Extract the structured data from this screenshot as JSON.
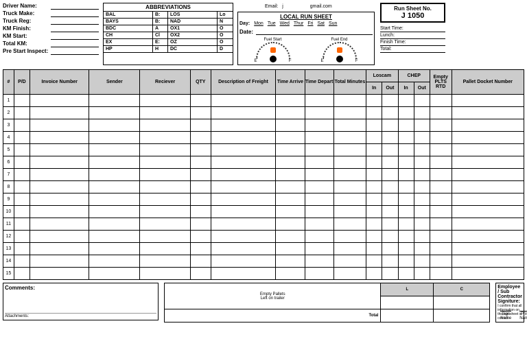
{
  "driver": {
    "fields": [
      "Driver Name:",
      "Truck Make:",
      "Truck Reg:",
      "KM Finish:",
      "KM Start:",
      "Total KM:",
      "Pre Start Inspect:"
    ]
  },
  "abb": {
    "title": "ABBREVIATIONS",
    "rows": [
      [
        "BAL",
        "B:",
        "LOS",
        "Lo"
      ],
      [
        "BAYS",
        "B:",
        "NAD",
        "N"
      ],
      [
        "BDC",
        "A",
        "OX1",
        "O"
      ],
      [
        "CH",
        "Cl",
        "OX2",
        "O"
      ],
      [
        "EX",
        "E:",
        "OZ",
        "O"
      ],
      [
        "HP",
        "H",
        "DC",
        "D"
      ]
    ]
  },
  "maintitle": "    ",
  "emailprefix": "Email:",
  "emailsuffix": "gmail.com",
  "emailmid": "j",
  "run": {
    "title": "LOCAL RUN SHEET",
    "daylabel": "Day:",
    "days": [
      "Mon",
      "Tue",
      "Wed",
      "Thur",
      "Fri",
      "Sat",
      "Sun"
    ],
    "datelabel": "Date:",
    "fuelstart": "Fuel Start",
    "fuelend": "Fuel End",
    "e": "E",
    "f": "F"
  },
  "sheet": {
    "label": "Run Sheet No.",
    "no": "J 1050"
  },
  "times": [
    "Start Time:",
    "Lunch:",
    "Finish Time:",
    "Total:"
  ],
  "cols": {
    "num": "#",
    "pd": "P/D",
    "inv": "Invoice Number",
    "sender": "Sender",
    "recv": "Reciever",
    "qty": "QTY",
    "desc": "Description of Freight",
    "tarr": "Time Arrive",
    "tdep": "Time Depart",
    "tmin": "Total Minutes",
    "loscam": "Loscam",
    "chep": "CHEP",
    "in": "In",
    "out": "Out",
    "empty": "Empty PLTS RTD",
    "pallet": "Pallet Docket Number"
  },
  "rows": [
    "1",
    "2",
    "3",
    "4",
    "5",
    "6",
    "7",
    "8",
    "9",
    "10",
    "11",
    "12",
    "13",
    "14",
    "15"
  ],
  "comments": {
    "hdr": "Comments:",
    "att": "Attachments:"
  },
  "ep": {
    "l1": "Empty Pallets",
    "l2": "Left on trailer",
    "total": "Total",
    "L": "L",
    "C": "C"
  },
  "sig": {
    "hdr": "Employee / Sub Contractor Signiture:",
    "note": "I confirm that all information on this run sheet is correct",
    "sign": "Sign Name",
    "print": "Print Name"
  }
}
